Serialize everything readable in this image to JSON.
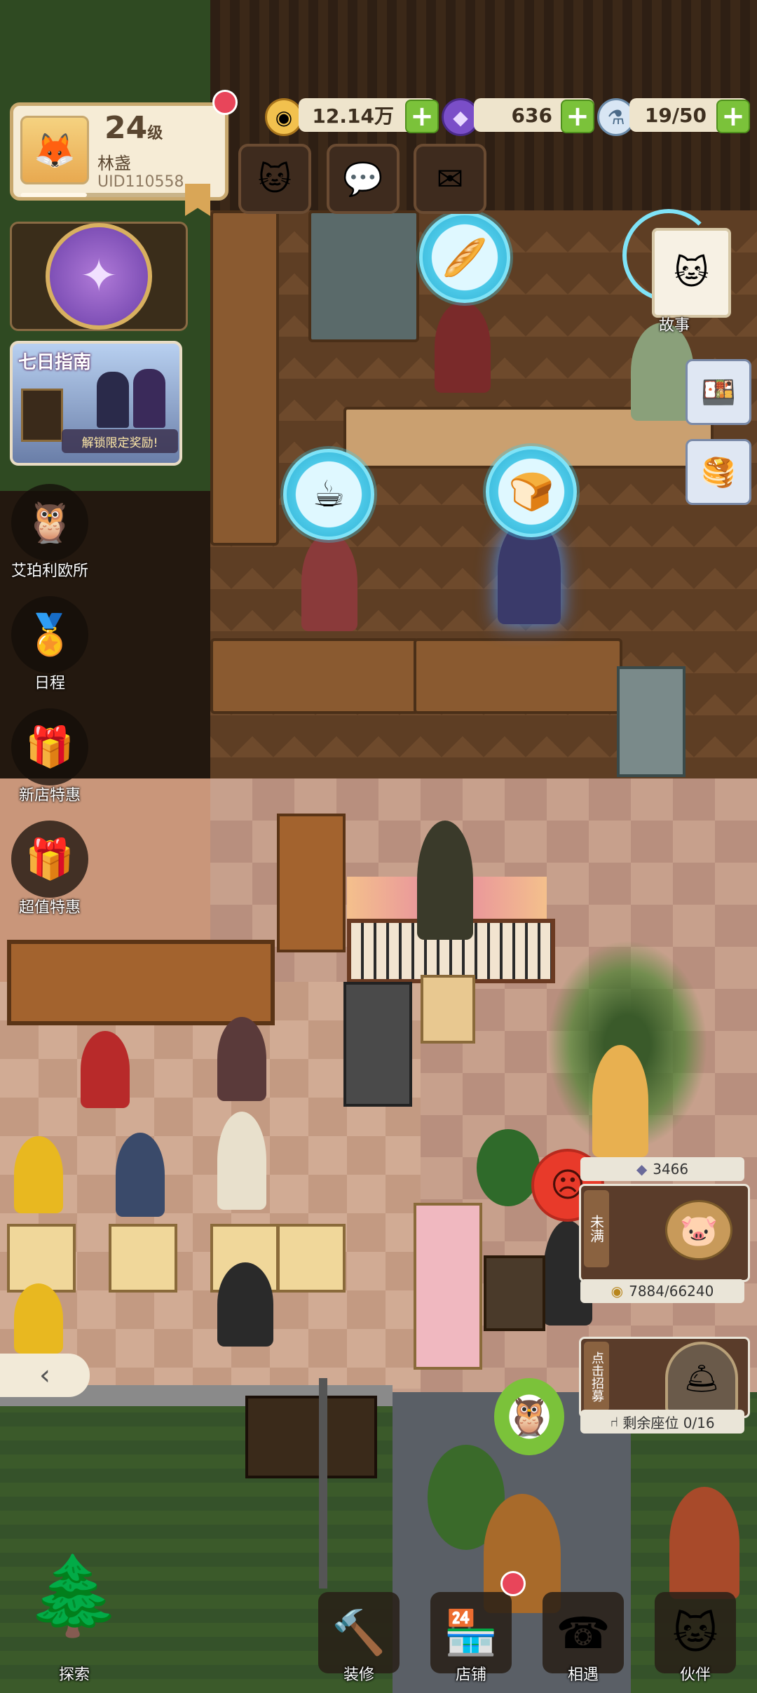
{
  "profile": {
    "level": "24",
    "level_suffix": "级",
    "name": "林盏",
    "uid": "UID110558",
    "xp_fraction": 0.35
  },
  "resources": {
    "coins": "12.14万",
    "gems": "636",
    "energy": "19/50"
  },
  "top_buttons": {
    "friends_icon": "cats-icon",
    "chat_icon": "chat-icon",
    "mail_icon": "mail-icon"
  },
  "left_menu": {
    "guide_title": "七日指南",
    "guide_promo": "解锁限定奖励!",
    "items": [
      {
        "label": "艾珀利欧所",
        "icon": "owl-detective-icon"
      },
      {
        "label": "日程",
        "icon": "badge-icon"
      },
      {
        "label": "新店特惠",
        "icon": "gift-icon"
      },
      {
        "label": "超值特惠",
        "icon": "gift-blue-icon"
      }
    ]
  },
  "story": {
    "label": "故事"
  },
  "customer_bubbles": [
    {
      "icon": "bread-icon",
      "glyph": "🥖"
    },
    {
      "icon": "coffee-icon",
      "glyph": "☕"
    },
    {
      "icon": "toast-icon",
      "glyph": "🍞"
    }
  ],
  "shop_panel": {
    "popularity": "3466",
    "status_tag": "未满",
    "coin_progress": "7884/66240",
    "recruit_tag": "点击招募",
    "seats": "剩余座位 0/16"
  },
  "bottom_nav": {
    "explore": "探索",
    "renovate": "装修",
    "shop": "店铺",
    "meet": "相遇",
    "partner": "伙伴"
  },
  "colors": {
    "accent_green": "#7bc23a",
    "bubble_cyan": "#4cc9e8",
    "badge_red": "#e8455a"
  }
}
